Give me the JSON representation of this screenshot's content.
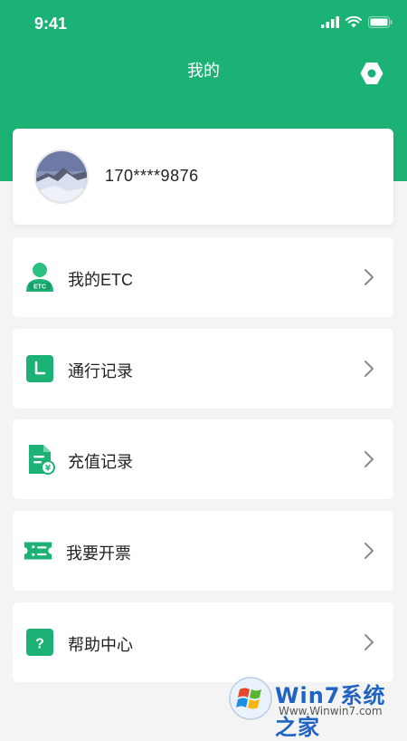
{
  "status_bar": {
    "time": "9:41"
  },
  "header": {
    "title": "我的"
  },
  "profile": {
    "phone": "170****9876"
  },
  "menu": {
    "items": [
      {
        "label": "我的ETC",
        "icon": "etc-user-icon",
        "badge": "ETC"
      },
      {
        "label": "通行记录",
        "icon": "clock-icon"
      },
      {
        "label": "充值记录",
        "icon": "recharge-doc-icon",
        "badge": "¥"
      },
      {
        "label": "我要开票",
        "icon": "ticket-icon"
      },
      {
        "label": "帮助中心",
        "icon": "help-icon",
        "badge": "?"
      }
    ]
  },
  "watermark": {
    "text": "Win7系统之家",
    "url": "Www.Winwin7.com"
  },
  "colors": {
    "brand": "#1cb275",
    "background": "#f4f4f4",
    "text": "#222222",
    "chevron": "#8a8a8a"
  }
}
